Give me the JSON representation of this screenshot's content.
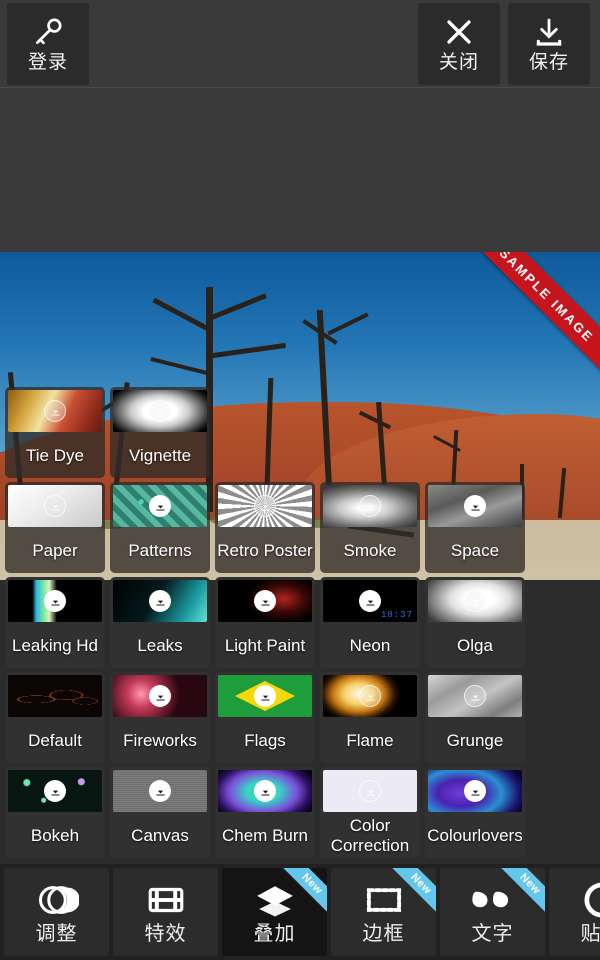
{
  "topbar": {
    "login": {
      "label": "登录",
      "icon": "key-icon"
    },
    "close": {
      "label": "关闭",
      "icon": "close-icon"
    },
    "save": {
      "label": "保存",
      "icon": "download-icon"
    }
  },
  "photo": {
    "ribbon_text": "SAMPLE IMAGE",
    "ribbon_color": "#c4161c",
    "scene": "desert dead trees with orange dunes and blue sky"
  },
  "overlay_panel": {
    "rows": [
      [
        {
          "label": "Tie Dye",
          "art": "a-tiedye",
          "dl": "ghost"
        },
        {
          "label": "Vignette",
          "art": "a-vignette",
          "dl": "ghost"
        }
      ],
      [
        {
          "label": "Paper",
          "art": "a-paper",
          "dl": "ghost"
        },
        {
          "label": "Patterns",
          "art": "a-patterns",
          "dl": "solid"
        },
        {
          "label": "Retro Poster",
          "art": "a-retro",
          "dl": "ghost"
        },
        {
          "label": "Smoke",
          "art": "a-smoke",
          "dl": "ghost"
        },
        {
          "label": "Space",
          "art": "a-space",
          "dl": "solid"
        }
      ],
      [
        {
          "label": "Leaking Hd",
          "art": "a-leakinghd",
          "dl": "solid"
        },
        {
          "label": "Leaks",
          "art": "a-leaks",
          "dl": "solid"
        },
        {
          "label": "Light Paint",
          "art": "a-lightpaint",
          "dl": "solid"
        },
        {
          "label": "Neon",
          "art": "a-neon",
          "dl": "solid"
        },
        {
          "label": "Olga",
          "art": "a-olga",
          "dl": "ghost"
        }
      ],
      [
        {
          "label": "Default",
          "art": "a-default",
          "dl": "none",
          "selected": true
        },
        {
          "label": "Fireworks",
          "art": "a-fireworks",
          "dl": "solid"
        },
        {
          "label": "Flags",
          "art": "a-flags",
          "dl": "solid"
        },
        {
          "label": "Flame",
          "art": "a-flame",
          "dl": "ghost"
        },
        {
          "label": "Grunge",
          "art": "a-grunge",
          "dl": "ghost"
        }
      ],
      [
        {
          "label": "Bokeh",
          "art": "a-bokeh",
          "dl": "solid"
        },
        {
          "label": "Canvas",
          "art": "a-canvas",
          "dl": "solid"
        },
        {
          "label": "Chem Burn",
          "art": "a-chemburn",
          "dl": "solid"
        },
        {
          "label": "Color Correction",
          "art": "a-colorcorr",
          "dl": "ghost"
        },
        {
          "label": "Colourlovers",
          "art": "a-colourlove",
          "dl": "solid"
        }
      ]
    ]
  },
  "bottombar": {
    "new_badge": "New",
    "new_badge_color": "#63c6ea",
    "tabs": [
      {
        "label": "调整",
        "icon": "adjust-circles-icon",
        "active": false,
        "badge": false
      },
      {
        "label": "特效",
        "icon": "film-strip-icon",
        "active": false,
        "badge": false
      },
      {
        "label": "叠加",
        "icon": "layers-icon",
        "active": true,
        "badge": true
      },
      {
        "label": "边框",
        "icon": "frame-icon",
        "active": false,
        "badge": true
      },
      {
        "label": "文字",
        "icon": "quote-marks-icon",
        "active": false,
        "badge": true
      },
      {
        "label": "贴纸",
        "icon": "sticker-circle-icon",
        "active": false,
        "badge": false
      }
    ]
  }
}
